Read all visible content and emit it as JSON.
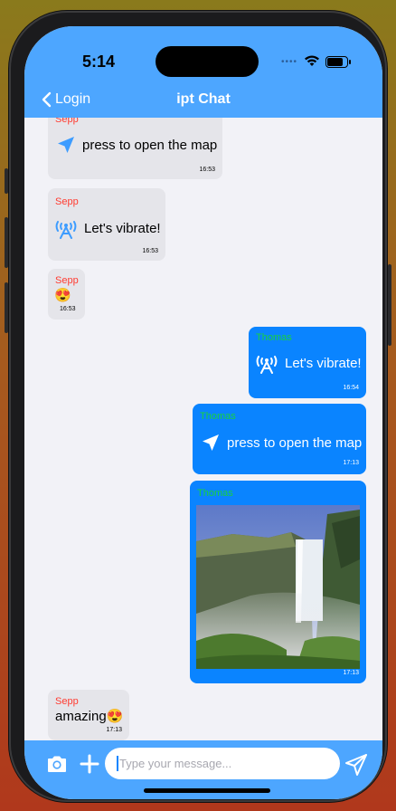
{
  "status_bar": {
    "time": "5:14"
  },
  "nav": {
    "back_label": "Login",
    "title": "ipt Chat"
  },
  "messages": [
    {
      "sender": "Sepp",
      "text": "press to open the map",
      "time": "16:53",
      "icon": "location-arrow-icon"
    },
    {
      "sender": "Sepp",
      "text": "Let's vibrate!",
      "time": "16:53",
      "icon": "antenna-icon"
    },
    {
      "sender": "Sepp",
      "text": "😍",
      "time": "16:53"
    },
    {
      "sender": "Thomas",
      "text": "Let's vibrate!",
      "time": "16:54",
      "icon": "antenna-icon"
    },
    {
      "sender": "Thomas",
      "text": "press to open the map",
      "time": "17:13",
      "icon": "location-arrow-icon"
    },
    {
      "sender": "Thomas",
      "time": "17:13",
      "image": "waterfall-photo"
    },
    {
      "sender": "Sepp",
      "text": "amazing😍",
      "time": "17:13"
    }
  ],
  "composer": {
    "placeholder": "Type your message..."
  },
  "colors": {
    "nav_bg": "#4da6ff",
    "outgoing_bubble": "#0a84ff",
    "incoming_bubble": "#e5e5ea",
    "incoming_sender": "#ff3b30",
    "outgoing_sender": "#19d13c",
    "chat_bg": "#f2f2f7"
  }
}
